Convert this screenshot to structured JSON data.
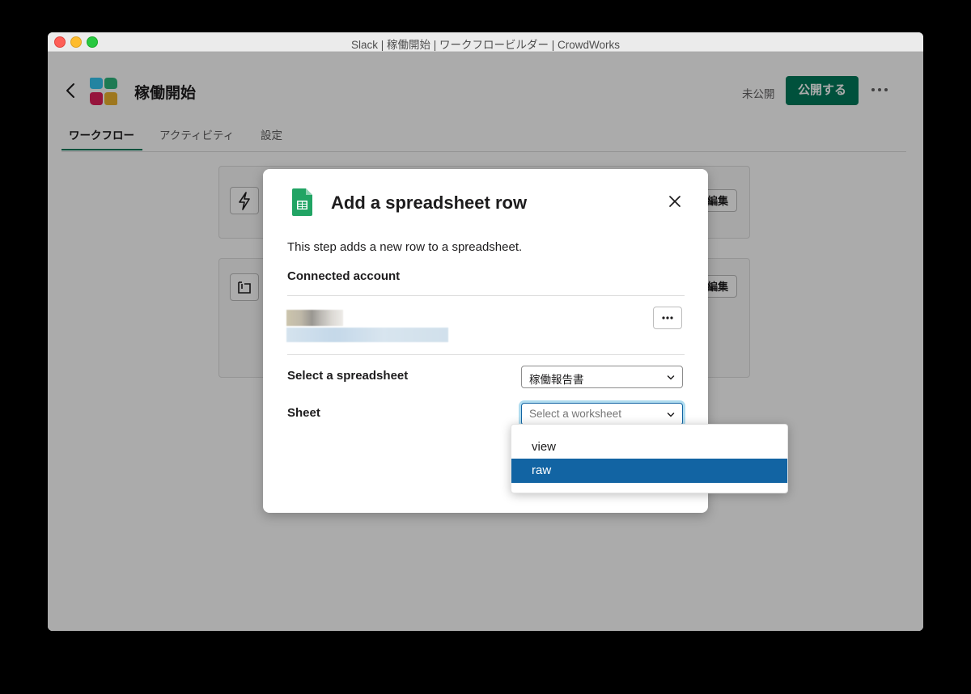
{
  "window": {
    "title": "Slack | 稼働開始 | ワークフロービルダー | CrowdWorks"
  },
  "header": {
    "workflow_name": "稼働開始",
    "status": "未公開",
    "publish_label": "公開する"
  },
  "tabs": [
    {
      "label": "ワークフロー",
      "active": true
    },
    {
      "label": "アクティビティ",
      "active": false
    },
    {
      "label": "設定",
      "active": false
    }
  ],
  "steps": [
    {
      "icon": "lightning-icon",
      "edit_label": "編集"
    },
    {
      "icon": "form-icon",
      "edit_label": "編集"
    }
  ],
  "modal": {
    "title": "Add a spreadsheet row",
    "description": "This step adds a new row to a spreadsheet.",
    "connected_account_label": "Connected account",
    "spreadsheet_label": "Select a spreadsheet",
    "spreadsheet_value": "稼働報告書",
    "sheet_label": "Sheet",
    "sheet_placeholder": "Select a worksheet"
  },
  "dropdown": {
    "options": [
      {
        "label": "view",
        "selected": false
      },
      {
        "label": "raw",
        "selected": true
      }
    ]
  },
  "colors": {
    "primary_green": "#007a5a",
    "selection_blue": "#1264a3",
    "sheets_green": "#21a464"
  }
}
